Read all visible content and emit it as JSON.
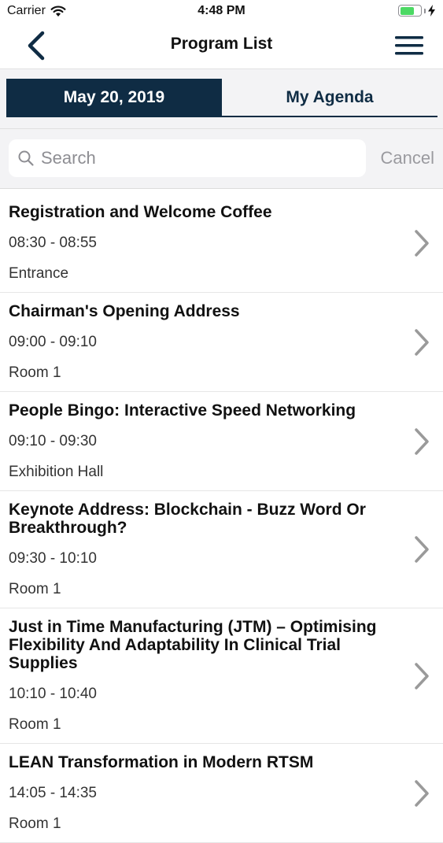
{
  "status_bar": {
    "carrier": "Carrier",
    "time": "4:48 PM",
    "battery_level": 0.7
  },
  "nav": {
    "title": "Program List"
  },
  "tabs": [
    {
      "label": "May 20, 2019",
      "selected": true
    },
    {
      "label": "My Agenda",
      "selected": false
    }
  ],
  "search": {
    "placeholder": "Search",
    "value": "",
    "cancel_label": "Cancel"
  },
  "sessions": [
    {
      "title": "Registration and Welcome Coffee",
      "time": "08:30 - 08:55",
      "room": "Entrance"
    },
    {
      "title": "Chairman's Opening Address",
      "time": "09:00 - 09:10",
      "room": "Room 1"
    },
    {
      "title": "People Bingo: Interactive Speed Networking",
      "time": "09:10 - 09:30",
      "room": "Exhibition Hall"
    },
    {
      "title": "Keynote Address: Blockchain - Buzz Word Or Breakthrough?",
      "time": "09:30 - 10:10",
      "room": "Room 1"
    },
    {
      "title": "Just in Time Manufacturing (JTM) – Optimising Flexibility And Adaptability In Clinical Trial Supplies",
      "time": "10:10 - 10:40",
      "room": "Room 1"
    },
    {
      "title": "LEAN Transformation in Modern RTSM",
      "time": "14:05 - 14:35",
      "room": "Room 1"
    }
  ],
  "colors": {
    "primary": "#0f2c44",
    "battery": "#4cd964",
    "chevron": "#9a9a9a"
  }
}
